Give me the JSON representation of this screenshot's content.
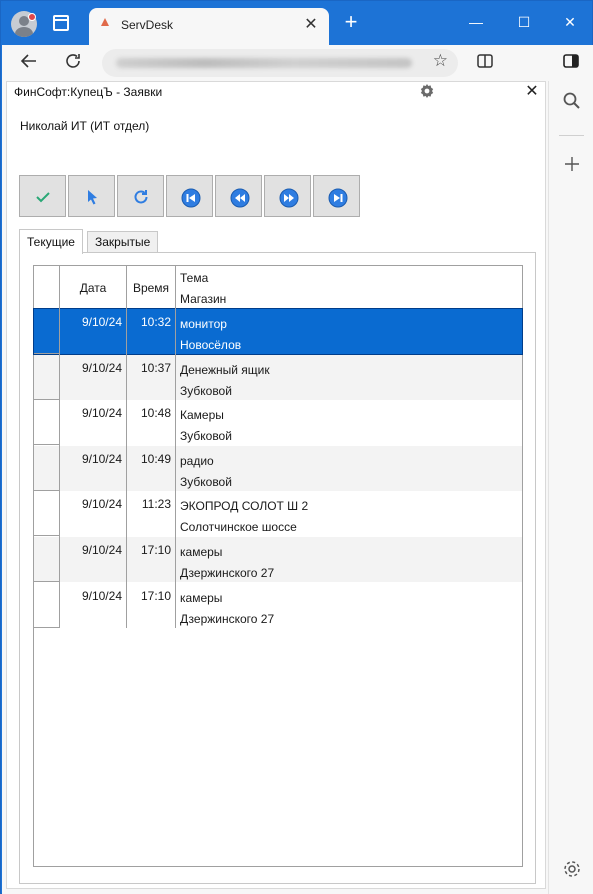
{
  "browser": {
    "tab_title": "ServDesk",
    "close_glyph": "✕",
    "newtab_glyph": "+",
    "window_buttons": [
      "—",
      "☐",
      "✕"
    ],
    "address": "",
    "icons": [
      "back-arrow-icon",
      "refresh-icon",
      "star-icon",
      "split-screen-icon",
      "sidebar-icon",
      "search-icon",
      "plus-icon",
      "gear-icon"
    ]
  },
  "app": {
    "title": "ФинСофт:КупецЪ - Заявки",
    "user": "Николай ИТ (ИТ отдел)",
    "toolbar": [
      "check-icon",
      "pointer-icon",
      "refresh-icon",
      "first-icon",
      "prev-icon",
      "next-icon",
      "last-icon"
    ],
    "tabs": [
      {
        "label": "Текущие",
        "active": true
      },
      {
        "label": "Закрытые",
        "active": false
      }
    ],
    "grid": {
      "headers": {
        "date": "Дата",
        "time": "Время",
        "topic": "Тема",
        "shop": "Магазин"
      },
      "rows": [
        {
          "date": "9/10/24",
          "time": "10:32",
          "topic": "монитор",
          "shop": "Новосёлов",
          "selected": true
        },
        {
          "date": "9/10/24",
          "time": "10:37",
          "topic": "Денежный ящик",
          "shop": "Зубковой",
          "selected": false
        },
        {
          "date": "9/10/24",
          "time": "10:48",
          "topic": "Камеры",
          "shop": "Зубковой",
          "selected": false
        },
        {
          "date": "9/10/24",
          "time": "10:49",
          "topic": "радио",
          "shop": "Зубковой",
          "selected": false
        },
        {
          "date": "9/10/24",
          "time": "11:23",
          "topic": "ЭКОПРОД СОЛОТ Ш 2",
          "shop": "Солотчинское шоссе",
          "selected": false
        },
        {
          "date": "9/10/24",
          "time": "17:10",
          "topic": "камеры",
          "shop": "Дзержинского 27",
          "selected": false
        },
        {
          "date": "9/10/24",
          "time": "17:10",
          "topic": "камеры",
          "shop": "Дзержинского 27",
          "selected": false
        }
      ]
    },
    "colors": {
      "selection": "#0a6bd1",
      "browser_accent": "#1d73d6",
      "icon_blue": "#2f7de1",
      "check_green": "#2aa876"
    }
  }
}
